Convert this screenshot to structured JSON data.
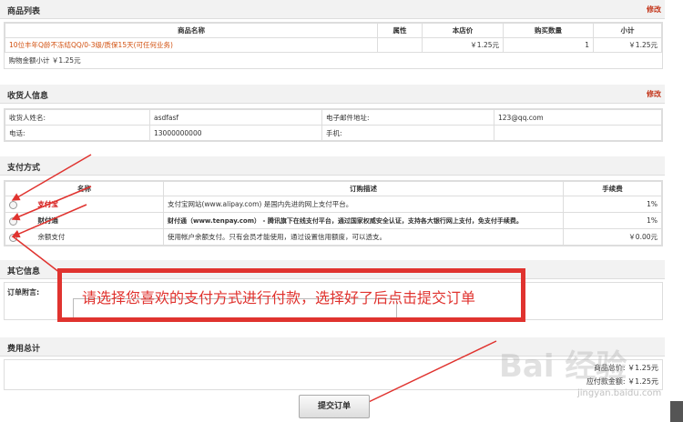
{
  "products": {
    "title": "商品列表",
    "edit": "修改",
    "headers": [
      "商品名称",
      "属性",
      "本店价",
      "购买数量",
      "小计"
    ],
    "rows": [
      [
        "10位丰年Q龄不冻结QQ/0-3级/质保15天(可任何业务)",
        "",
        "￥1.25元",
        "1",
        "￥1.25元"
      ]
    ],
    "total": "购物金额小计 ￥1.25元"
  },
  "consignee": {
    "title": "收货人信息",
    "edit": "修改",
    "rows": [
      [
        "收货人姓名:",
        "asdfasf",
        "电子邮件地址:",
        "123@qq.com"
      ],
      [
        "电话:",
        "13000000000",
        "手机:",
        ""
      ]
    ]
  },
  "payment": {
    "title": "支付方式",
    "headers": [
      "名称",
      "订购描述",
      "手续费"
    ],
    "rows": [
      {
        "name": "支付宝",
        "desc": "支付宝网站(www.alipay.com) 是国内先进的网上支付平台。",
        "fee": "1%"
      },
      {
        "name": "财付通",
        "desc": "财付通（www.tenpay.com） - 腾讯旗下在线支付平台，通过国家权威安全认证，支持各大银行网上支付，免支付手续费。",
        "fee": "1%"
      },
      {
        "name": "余额支付",
        "desc": "使用帐户余额支付。只有会员才能使用，通过设置信用额度，可以透支。",
        "fee": "￥0.00元"
      }
    ]
  },
  "other": {
    "title": "其它信息",
    "message_label": "订单附言:"
  },
  "callout": "请选择您喜欢的支付方式进行付款，选择好了后点击提交订单",
  "cost": {
    "title": "费用总计",
    "line1": "商品总价: ￥1.25元",
    "line2": "应付款金额: ￥1.25元"
  },
  "submit_label": "提交订单",
  "watermark": {
    "main": "Bai 经验",
    "sub": "jingyan.baidu.com"
  }
}
